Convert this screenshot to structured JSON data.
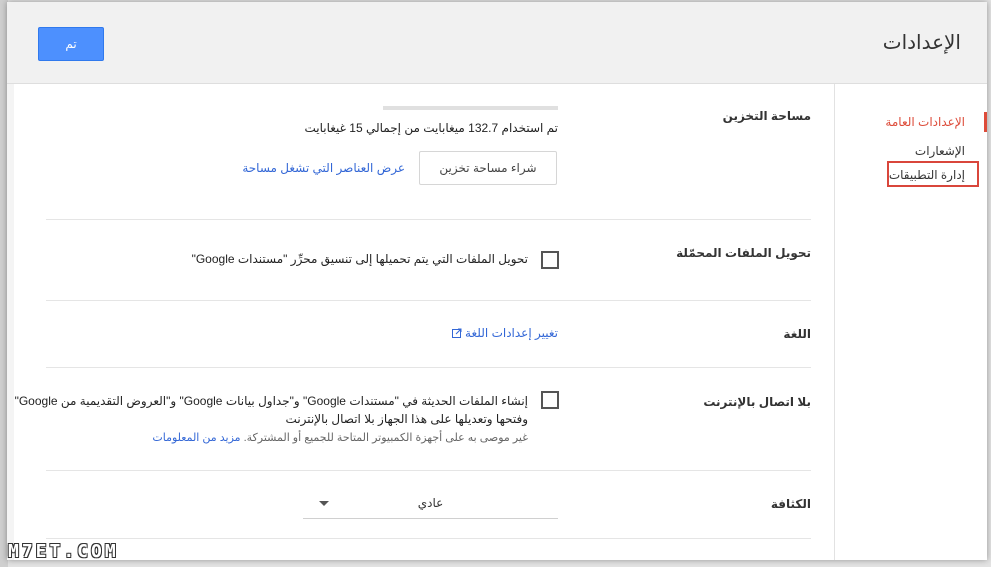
{
  "dialog": {
    "title": "الإعدادات",
    "done_label": "تم"
  },
  "nav": {
    "items": [
      {
        "label": "الإعدادات العامة",
        "active": true
      },
      {
        "label": "الإشعارات",
        "active": false
      },
      {
        "label": "إدارة التطبيقات",
        "active": false
      }
    ]
  },
  "storage": {
    "label": "مساحة التخزين",
    "usage_text": "تم استخدام 132.7 ميغابايت من إجمالي 15 غيغابايت",
    "buy_label": "شراء مساحة تخزين",
    "view_items_link": "عرض العناصر التي تشغل مساحة"
  },
  "convert": {
    "label": "تحويل الملفات المحمّلة",
    "checkbox_text": "تحويل الملفات التي يتم تحميلها إلى تنسيق محرِّر \"مستندات Google\"",
    "checked": false
  },
  "language": {
    "label": "اللغة",
    "link": "تغيير إعدادات اللغة"
  },
  "offline": {
    "label": "بلا اتصال بالإنترنت",
    "line1": "إنشاء الملفات الحديثة في \"مستندات Google\" و\"جداول بيانات Google\" و\"العروض التقديمية من Google\"",
    "line2": "وفتحها وتعديلها على هذا الجهاز بلا اتصال بالإنترنت",
    "line3": "غير موصى به على أجهزة الكمبيوتر المتاحة للجميع أو المشتركة.",
    "more_link": "مزيد من المعلومات",
    "checked": false
  },
  "density": {
    "label": "الكثافة",
    "value": "عادي"
  },
  "watermark": "M7ET.COM",
  "colors": {
    "accent": "#4d90fe",
    "active_nav": "#dd4b39",
    "link": "#3367d6",
    "highlight_box": "#d9463b"
  }
}
